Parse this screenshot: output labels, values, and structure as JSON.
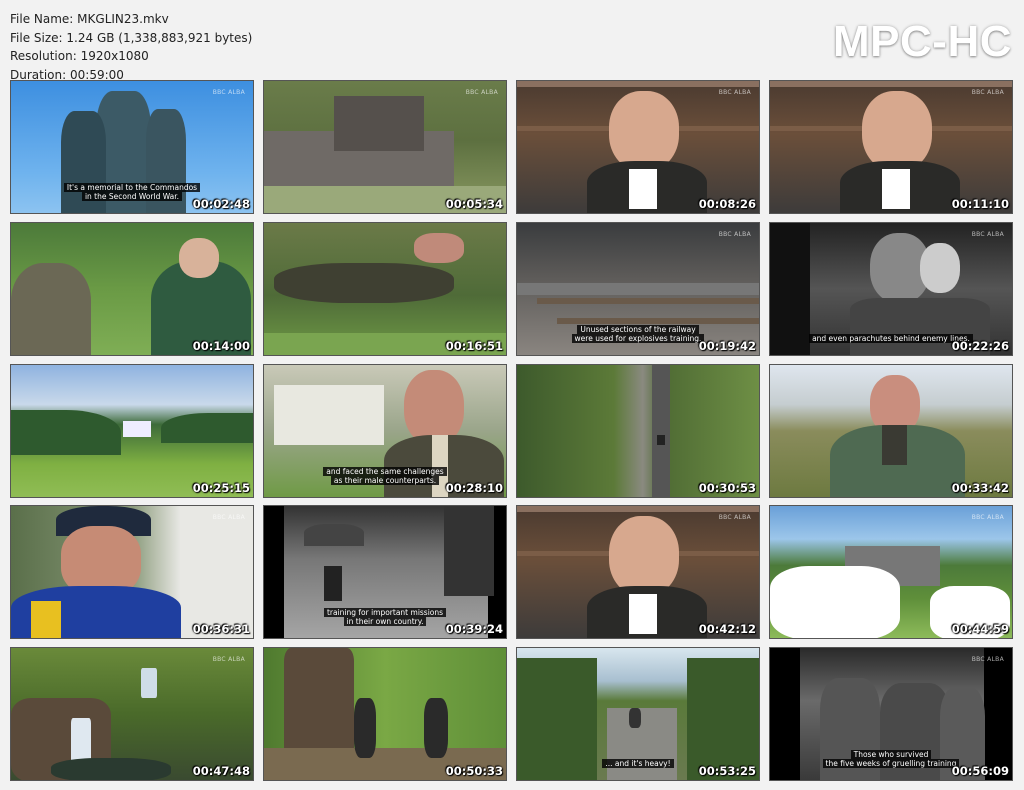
{
  "window": {
    "title": "MPC-HC"
  },
  "file_info": {
    "name_label": "File Name:",
    "name": "MKGLIN23.mkv",
    "size_label": "File Size:",
    "size": "1.24 GB (1,338,883,921 bytes)",
    "resolution_label": "Resolution:",
    "resolution": "1920x1080",
    "duration_label": "Duration:",
    "duration": "00:59:00"
  },
  "thumbnails": [
    {
      "time": "00:02:48",
      "subtitle": [
        "It's a memorial to the Commandos",
        "in the Second World War."
      ],
      "watermark": "BBC ALBA",
      "scene": "memorial"
    },
    {
      "time": "00:05:34",
      "subtitle": [],
      "watermark": "BBC ALBA",
      "scene": "lodge"
    },
    {
      "time": "00:08:26",
      "subtitle": [],
      "watermark": "BBC ALBA",
      "scene": "presenter-books"
    },
    {
      "time": "00:11:10",
      "subtitle": [],
      "watermark": "BBC ALBA",
      "scene": "presenter-books"
    },
    {
      "time": "00:14:00",
      "subtitle": [],
      "watermark": "",
      "scene": "two-men-outdoors"
    },
    {
      "time": "00:16:51",
      "subtitle": [],
      "watermark": "",
      "scene": "tumble"
    },
    {
      "time": "00:19:42",
      "subtitle": [
        "Unused sections of the railway",
        "were used for explosives training."
      ],
      "watermark": "BBC ALBA",
      "scene": "railway"
    },
    {
      "time": "00:22:26",
      "subtitle": [
        "and even parachutes behind enemy lines."
      ],
      "watermark": "BBC ALBA",
      "scene": "archive-car"
    },
    {
      "time": "00:25:15",
      "subtitle": [],
      "watermark": "",
      "scene": "valley"
    },
    {
      "time": "00:28:10",
      "subtitle": [
        "and faced the same challenges",
        "as their male counterparts."
      ],
      "watermark": "",
      "scene": "bald-man-house"
    },
    {
      "time": "00:30:53",
      "subtitle": [],
      "watermark": "",
      "scene": "aerial-road"
    },
    {
      "time": "00:33:42",
      "subtitle": [],
      "watermark": "",
      "scene": "bald-man-hills"
    },
    {
      "time": "00:36:31",
      "subtitle": [],
      "watermark": "BBC ALBA",
      "scene": "cap-man"
    },
    {
      "time": "00:39:24",
      "subtitle": [
        "training for important missions",
        "in their own country."
      ],
      "watermark": "",
      "scene": "archive-ski"
    },
    {
      "time": "00:42:12",
      "subtitle": [],
      "watermark": "BBC ALBA",
      "scene": "presenter-books"
    },
    {
      "time": "00:44:59",
      "subtitle": [],
      "watermark": "BBC ALBA",
      "scene": "daisies"
    },
    {
      "time": "00:47:48",
      "subtitle": [],
      "watermark": "BBC ALBA",
      "scene": "waterfall"
    },
    {
      "time": "00:50:33",
      "subtitle": [],
      "watermark": "",
      "scene": "tree-men"
    },
    {
      "time": "00:53:25",
      "subtitle": [
        "... and it's heavy!"
      ],
      "watermark": "",
      "scene": "road-walk"
    },
    {
      "time": "00:56:09",
      "subtitle": [
        "Those who survived",
        "the five weeks of gruelling training"
      ],
      "watermark": "BBC ALBA",
      "scene": "archive-soldiers"
    }
  ]
}
